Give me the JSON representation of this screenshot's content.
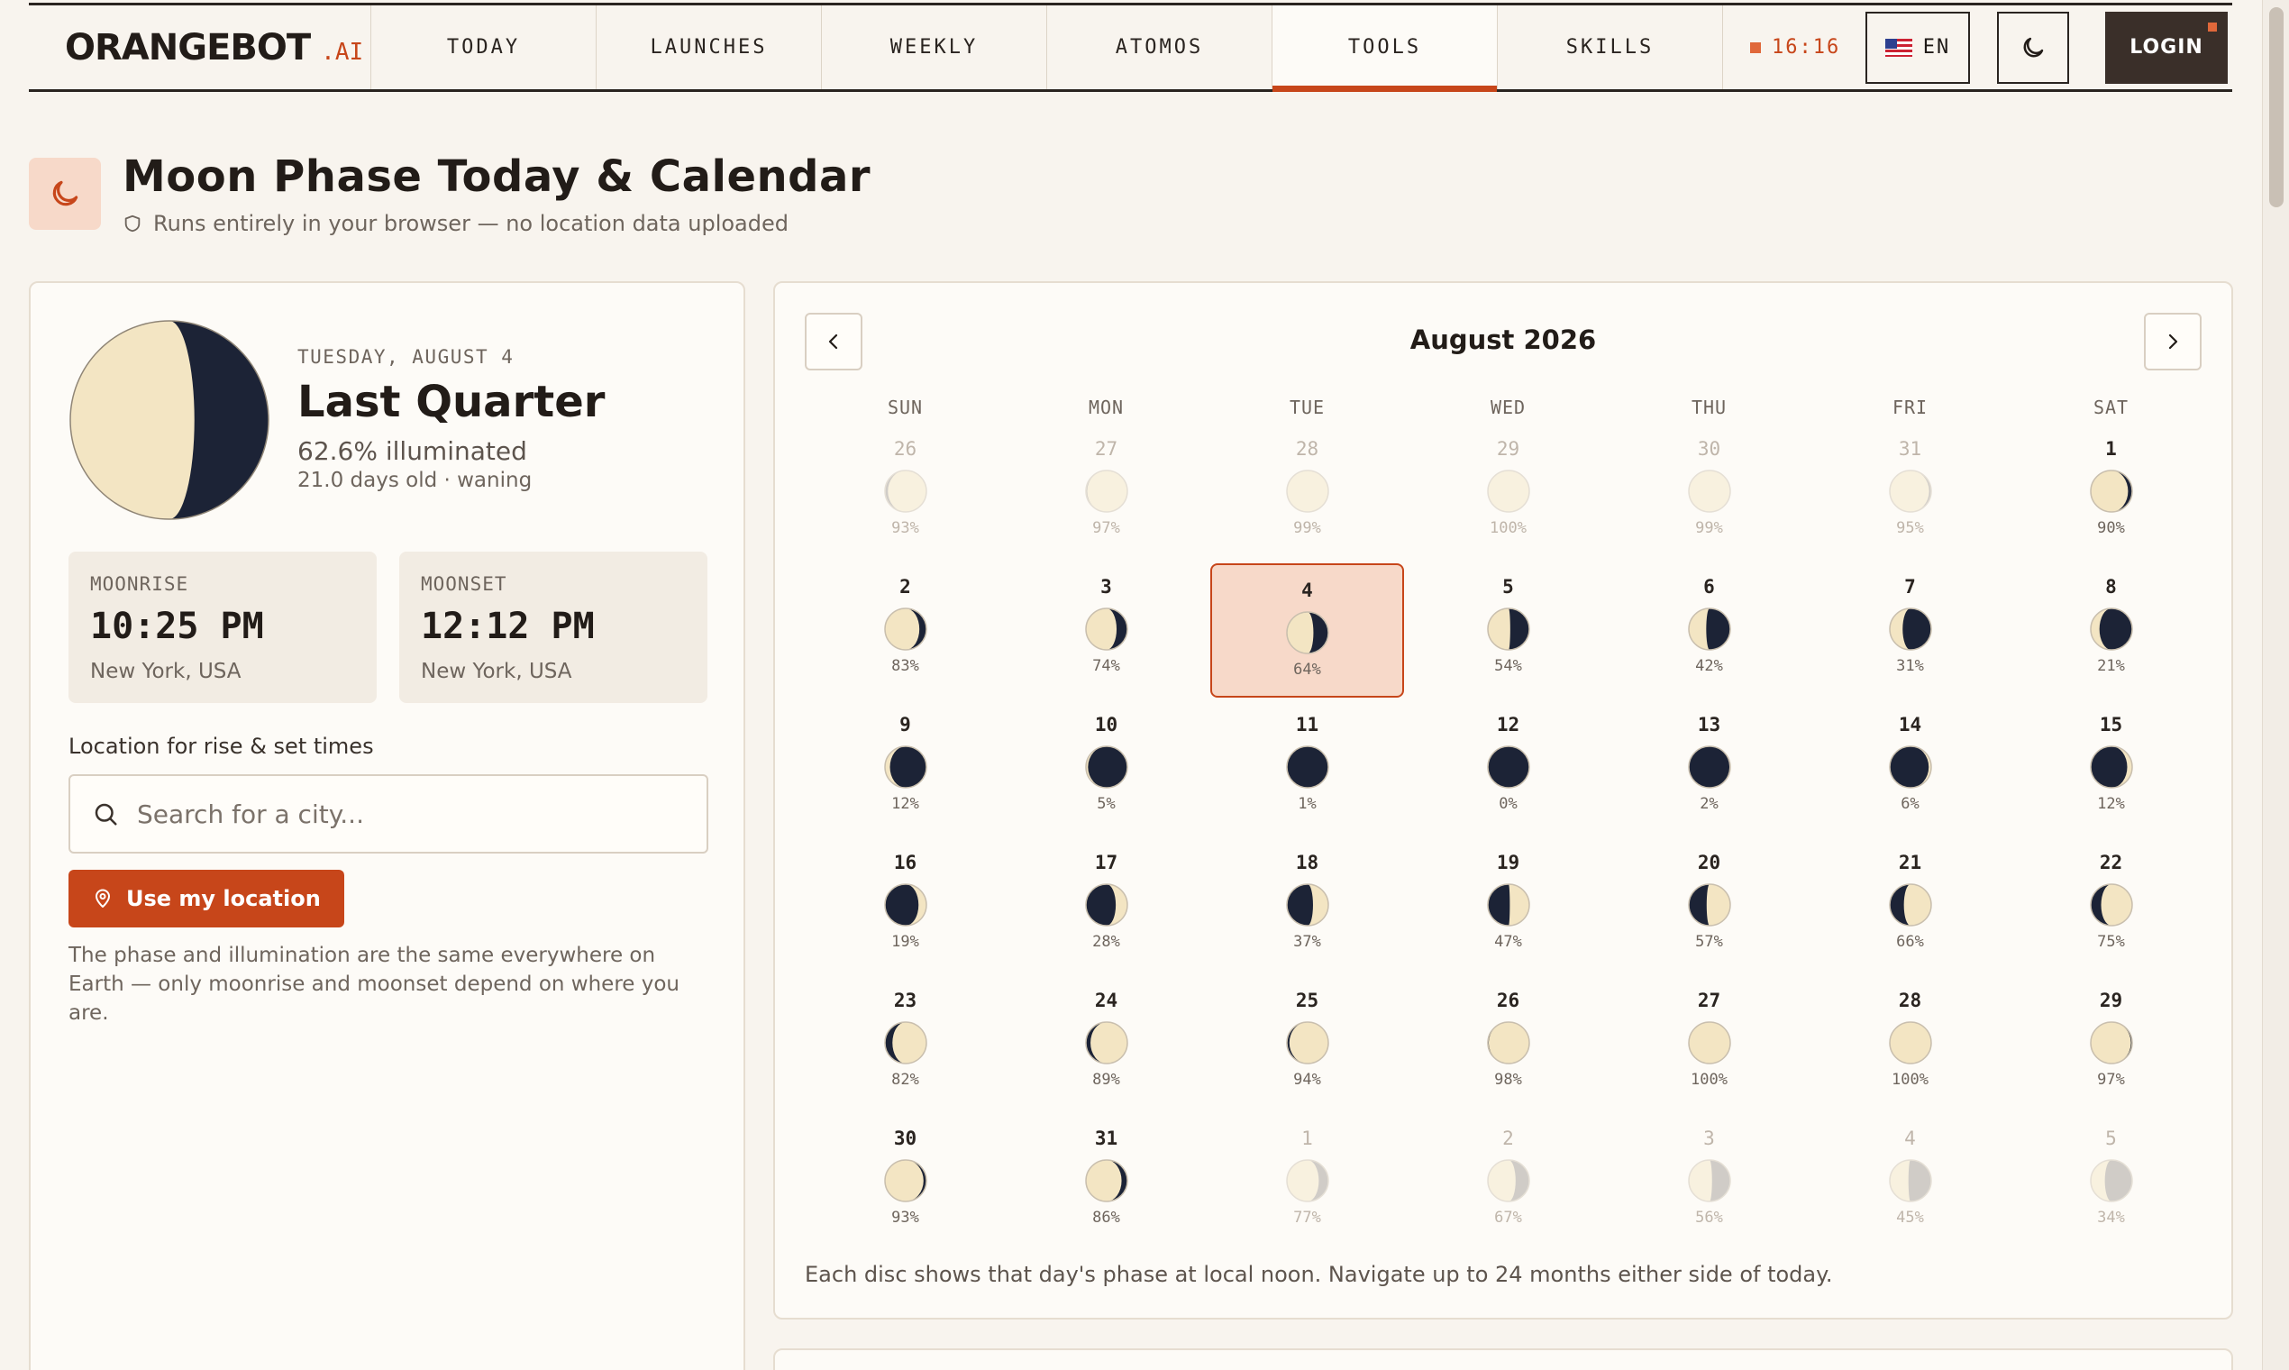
{
  "brand": {
    "name": "ORANGEBOT",
    "suffix": ".AI"
  },
  "nav": {
    "tabs": [
      {
        "label": "TODAY",
        "active": false
      },
      {
        "label": "LAUNCHES",
        "active": false
      },
      {
        "label": "WEEKLY",
        "active": false
      },
      {
        "label": "ATOMOS",
        "active": false
      },
      {
        "label": "TOOLS",
        "active": true
      },
      {
        "label": "SKILLS",
        "active": false
      }
    ],
    "clock": "16:16",
    "language": "EN",
    "login_label": "LOGIN"
  },
  "header": {
    "title": "Moon Phase Today & Calendar",
    "subtitle": "Runs entirely in your browser — no location data uploaded"
  },
  "today": {
    "date": "TUESDAY, AUGUST 4",
    "phase": "Last Quarter",
    "illumination": "62.6% illuminated",
    "age": "21.0 days old · waning",
    "illumination_fraction": 0.626
  },
  "moonrise": {
    "label": "MOONRISE",
    "time": "10:25 PM",
    "place": "New York, USA"
  },
  "moonset": {
    "label": "MOONSET",
    "time": "12:12 PM",
    "place": "New York, USA"
  },
  "location": {
    "label": "Location for rise & set times",
    "placeholder": "Search for a city...",
    "value": "",
    "use_location_label": "Use my location",
    "note": "The phase and illumination are the same everywhere on Earth — only moonrise and moonset depend on where you are."
  },
  "calendar": {
    "title": "August 2026",
    "weekdays": [
      "SUN",
      "MON",
      "TUE",
      "WED",
      "THU",
      "FRI",
      "SAT"
    ],
    "footer": "Each disc shows that day's phase at local noon. Navigate up to 24 months either side of today.",
    "days": [
      {
        "day": "26",
        "pct": "93%",
        "frac": 0.93,
        "waxing": true,
        "outside": true
      },
      {
        "day": "27",
        "pct": "97%",
        "frac": 0.97,
        "waxing": true,
        "outside": true
      },
      {
        "day": "28",
        "pct": "99%",
        "frac": 0.99,
        "waxing": true,
        "outside": true
      },
      {
        "day": "29",
        "pct": "100%",
        "frac": 1.0,
        "waxing": true,
        "outside": true
      },
      {
        "day": "30",
        "pct": "99%",
        "frac": 0.99,
        "waxing": false,
        "outside": true
      },
      {
        "day": "31",
        "pct": "95%",
        "frac": 0.95,
        "waxing": false,
        "outside": true
      },
      {
        "day": "1",
        "pct": "90%",
        "frac": 0.9,
        "waxing": false,
        "outside": false
      },
      {
        "day": "2",
        "pct": "83%",
        "frac": 0.83,
        "waxing": false,
        "outside": false
      },
      {
        "day": "3",
        "pct": "74%",
        "frac": 0.74,
        "waxing": false,
        "outside": false
      },
      {
        "day": "4",
        "pct": "64%",
        "frac": 0.64,
        "waxing": false,
        "outside": false,
        "today": true
      },
      {
        "day": "5",
        "pct": "54%",
        "frac": 0.54,
        "waxing": false,
        "outside": false
      },
      {
        "day": "6",
        "pct": "42%",
        "frac": 0.42,
        "waxing": false,
        "outside": false
      },
      {
        "day": "7",
        "pct": "31%",
        "frac": 0.31,
        "waxing": false,
        "outside": false
      },
      {
        "day": "8",
        "pct": "21%",
        "frac": 0.21,
        "waxing": false,
        "outside": false
      },
      {
        "day": "9",
        "pct": "12%",
        "frac": 0.12,
        "waxing": false,
        "outside": false
      },
      {
        "day": "10",
        "pct": "5%",
        "frac": 0.05,
        "waxing": false,
        "outside": false
      },
      {
        "day": "11",
        "pct": "1%",
        "frac": 0.01,
        "waxing": false,
        "outside": false
      },
      {
        "day": "12",
        "pct": "0%",
        "frac": 0.0,
        "waxing": true,
        "outside": false
      },
      {
        "day": "13",
        "pct": "2%",
        "frac": 0.02,
        "waxing": true,
        "outside": false
      },
      {
        "day": "14",
        "pct": "6%",
        "frac": 0.06,
        "waxing": true,
        "outside": false
      },
      {
        "day": "15",
        "pct": "12%",
        "frac": 0.12,
        "waxing": true,
        "outside": false
      },
      {
        "day": "16",
        "pct": "19%",
        "frac": 0.19,
        "waxing": true,
        "outside": false
      },
      {
        "day": "17",
        "pct": "28%",
        "frac": 0.28,
        "waxing": true,
        "outside": false
      },
      {
        "day": "18",
        "pct": "37%",
        "frac": 0.37,
        "waxing": true,
        "outside": false
      },
      {
        "day": "19",
        "pct": "47%",
        "frac": 0.47,
        "waxing": true,
        "outside": false
      },
      {
        "day": "20",
        "pct": "57%",
        "frac": 0.57,
        "waxing": true,
        "outside": false
      },
      {
        "day": "21",
        "pct": "66%",
        "frac": 0.66,
        "waxing": true,
        "outside": false
      },
      {
        "day": "22",
        "pct": "75%",
        "frac": 0.75,
        "waxing": true,
        "outside": false
      },
      {
        "day": "23",
        "pct": "82%",
        "frac": 0.82,
        "waxing": true,
        "outside": false
      },
      {
        "day": "24",
        "pct": "89%",
        "frac": 0.89,
        "waxing": true,
        "outside": false
      },
      {
        "day": "25",
        "pct": "94%",
        "frac": 0.94,
        "waxing": true,
        "outside": false
      },
      {
        "day": "26",
        "pct": "98%",
        "frac": 0.98,
        "waxing": true,
        "outside": false
      },
      {
        "day": "27",
        "pct": "100%",
        "frac": 1.0,
        "waxing": true,
        "outside": false
      },
      {
        "day": "28",
        "pct": "100%",
        "frac": 1.0,
        "waxing": false,
        "outside": false
      },
      {
        "day": "29",
        "pct": "97%",
        "frac": 0.97,
        "waxing": false,
        "outside": false
      },
      {
        "day": "30",
        "pct": "93%",
        "frac": 0.93,
        "waxing": false,
        "outside": false
      },
      {
        "day": "31",
        "pct": "86%",
        "frac": 0.86,
        "waxing": false,
        "outside": false
      },
      {
        "day": "1",
        "pct": "77%",
        "frac": 0.77,
        "waxing": false,
        "outside": true
      },
      {
        "day": "2",
        "pct": "67%",
        "frac": 0.67,
        "waxing": false,
        "outside": true
      },
      {
        "day": "3",
        "pct": "56%",
        "frac": 0.56,
        "waxing": false,
        "outside": true
      },
      {
        "day": "4",
        "pct": "45%",
        "frac": 0.45,
        "waxing": false,
        "outside": true
      },
      {
        "day": "5",
        "pct": "34%",
        "frac": 0.34,
        "waxing": false,
        "outside": true
      }
    ]
  },
  "colors": {
    "accent": "#c7461a",
    "moon_light": "#f3e5c3",
    "moon_dark": "#1c2336",
    "background": "#f8f4ee"
  },
  "icons": {
    "page_icon": "crescent-moon-icon",
    "shield": "shield-icon",
    "search": "search-icon",
    "pin": "location-pin-icon",
    "prev": "chevron-left-icon",
    "next": "chevron-right-icon",
    "theme": "moon-icon",
    "flag": "us-flag-icon"
  }
}
